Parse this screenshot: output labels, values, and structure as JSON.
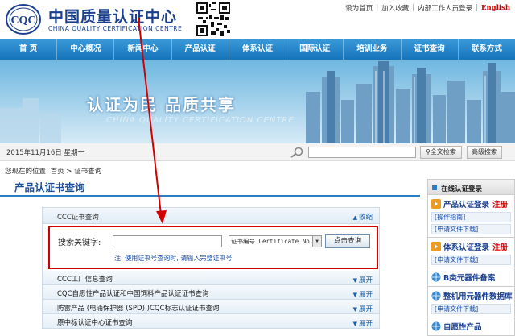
{
  "header": {
    "logo_text": "CQC",
    "org_cn": "中国质量认证中心",
    "org_en": "CHINA QUALITY CERTIFICATION CENTRE",
    "top_links": [
      "设为首页",
      "加入收藏",
      "内部工作人员登录",
      "English"
    ]
  },
  "nav": {
    "items": [
      "首 页",
      "中心概况",
      "新闻中心",
      "产品认证",
      "体系认证",
      "国际认证",
      "培训业务",
      "证书查询",
      "联系方式"
    ]
  },
  "banner": {
    "slogan": "认证为民  品质共享",
    "slogan_en": "CHINA QUALITY CERTIFICATION CENTRE"
  },
  "datebar": {
    "date": "2015年11月16日  星期一",
    "search_placeholder": "",
    "fulltext_label": "全文检索",
    "advanced_label": "高级搜索"
  },
  "breadcrumb": {
    "prefix": "您现在的位置:",
    "home": "首页",
    "sep": ">",
    "current": "证书查询"
  },
  "page_title": "产品认证书查询",
  "panel": {
    "title": "CCC证书查询",
    "collapse_label": "收缩",
    "keyword_label": "搜索关键字:",
    "keyword_value": "",
    "select_value": "证书编号 Certificate No.",
    "query_label": "点击查询",
    "note": "注: 使用证书号查询时, 请输入完整证书号"
  },
  "rows": [
    {
      "title": "CCC工厂信息查询",
      "toggle": "展开"
    },
    {
      "title": "CQC自愿性产品认证和中国饲料产品认证证书查询",
      "toggle": "展开"
    },
    {
      "title": "防雷产品 (电涌保护器 (SPD) )CQC标志认证证书查询",
      "toggle": "展开"
    },
    {
      "title": "原中标认证中心证书查询",
      "toggle": "展开"
    }
  ],
  "sidebar": {
    "head": "在线认证登录",
    "blocks": [
      {
        "title": "产品认证登录",
        "reg": "注册",
        "links": [
          "[操作指南]",
          "[申请文件下载]"
        ]
      },
      {
        "title": "体系认证登录",
        "reg": "注册",
        "links": [
          "[申请文件下载]"
        ]
      },
      {
        "title": "B类元器件备案",
        "reg": "",
        "links": []
      },
      {
        "title": "整机用元器件数据库",
        "reg": "",
        "links": [
          "[申请文件下载]"
        ]
      },
      {
        "title": "自愿性产品",
        "reg": "",
        "links": []
      }
    ]
  },
  "colors": {
    "nav_blue": "#1574bb",
    "title_blue": "#1a4f9a",
    "highlight_red": "#d20000"
  }
}
